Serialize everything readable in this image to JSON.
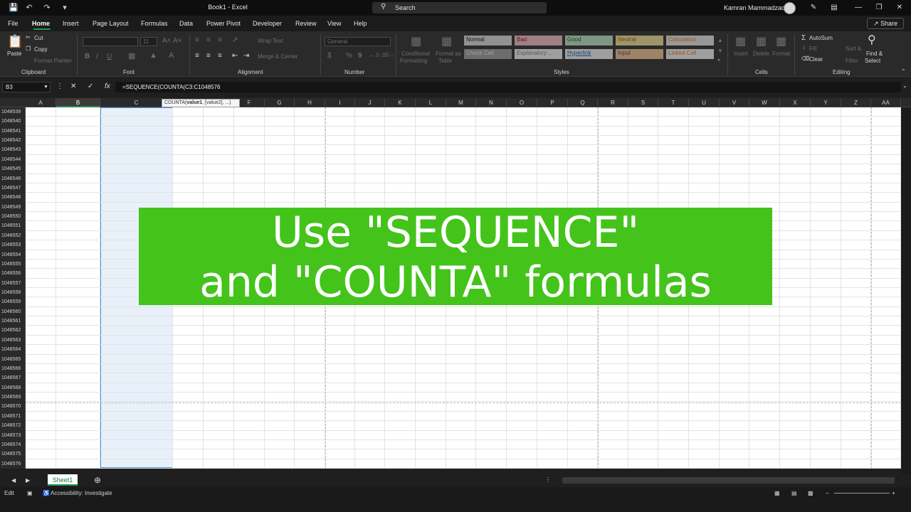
{
  "window": {
    "title": "Book1 - Excel",
    "search_label": "Search",
    "user_name": "Kamran Mammadzada"
  },
  "menu": {
    "tabs": [
      "File",
      "Home",
      "Insert",
      "Page Layout",
      "Formulas",
      "Data",
      "Power Pivot",
      "Developer",
      "Review",
      "View",
      "Help"
    ],
    "share_label": "Share"
  },
  "ribbon": {
    "clipboard": {
      "paste": "Paste",
      "cut": "Cut",
      "copy": "Copy",
      "format_painter": "Format Painter",
      "group": "Clipboard"
    },
    "font": {
      "group": "Font",
      "size": "11",
      "bold": "B",
      "italic": "I",
      "underline": "U"
    },
    "alignment": {
      "group": "Alignment",
      "wrap_text": "Wrap Text",
      "merge_center": "Merge & Center"
    },
    "number": {
      "group": "Number",
      "format": "General",
      "currency": "$",
      "percent": "%",
      "comma": "9"
    },
    "styles": {
      "group": "Styles",
      "conditional_formatting": [
        "Conditional",
        "Formatting"
      ],
      "format_as_table": [
        "Format as",
        "Table"
      ],
      "cells": [
        {
          "label": "Normal",
          "bg": "#e8e8e8",
          "fg": "#000000"
        },
        {
          "label": "Bad",
          "bg": "#ffc7ce",
          "fg": "#9c0006"
        },
        {
          "label": "Good",
          "bg": "#c6efce",
          "fg": "#006100"
        },
        {
          "label": "Neutral",
          "bg": "#ffeb9c",
          "fg": "#9c5700"
        },
        {
          "label": "Calculation",
          "bg": "#f2f2f2",
          "fg": "#fa7d00"
        },
        {
          "label": "Check Cell",
          "bg": "#a5a5a5",
          "fg": "#ffffff"
        },
        {
          "label": "Explanatory ...",
          "bg": "#ffffff",
          "fg": "#7f7f7f"
        },
        {
          "label": "Hyperlink",
          "bg": "#ffffff",
          "fg": "#0563c1"
        },
        {
          "label": "Input",
          "bg": "#ffcc99",
          "fg": "#3f3f76"
        },
        {
          "label": "Linked Cell",
          "bg": "#ffffff",
          "fg": "#fa7d00"
        }
      ]
    },
    "cells": {
      "group": "Cells",
      "insert": "Insert",
      "delete": "Delete",
      "format": "Format"
    },
    "editing": {
      "group": "Editing",
      "autosum": "AutoSum",
      "fill": "Fill",
      "clear": "Clear",
      "sort_filter": [
        "Sort &",
        "Filter"
      ],
      "find_select": [
        "Find &",
        "Select"
      ]
    }
  },
  "formula_bar": {
    "name_box": "B3",
    "formula": "=SEQUENCE(COUNTA(C3:C1048576",
    "tooltip_fn": "COUNTA(",
    "tooltip_arg1": "value1",
    "tooltip_rest": ", [value2], ...)"
  },
  "grid": {
    "columns": [
      "A",
      "B",
      "C",
      "D",
      "E",
      "F",
      "G",
      "H",
      "I",
      "J",
      "K",
      "L",
      "M",
      "N",
      "O",
      "P",
      "Q",
      "R",
      "S",
      "T",
      "U",
      "V",
      "W",
      "X",
      "Y",
      "Z",
      "AA"
    ],
    "selected_column": "B",
    "rows": [
      "1048539",
      "1048540",
      "1048541",
      "1048542",
      "1048543",
      "1048544",
      "1048545",
      "1048546",
      "1048547",
      "1048548",
      "1048549",
      "1048550",
      "1048551",
      "1048552",
      "1048553",
      "1048554",
      "1048555",
      "1048556",
      "1048557",
      "1048558",
      "1048559",
      "1048560",
      "1048561",
      "1048562",
      "1048563",
      "1048564",
      "1048565",
      "1048566",
      "1048567",
      "1048568",
      "1048569",
      "1048570",
      "1048571",
      "1048572",
      "1048573",
      "1048574",
      "1048575",
      "1048576"
    ]
  },
  "banner": {
    "line1": "Use \"SEQUENCE\"",
    "line2": "and \"COUNTA\" formulas",
    "color": "#44c31b"
  },
  "sheets": {
    "tabs": [
      "Sheet1"
    ]
  },
  "status": {
    "mode": "Edit",
    "accessibility": "Accessibility: Investigate"
  }
}
